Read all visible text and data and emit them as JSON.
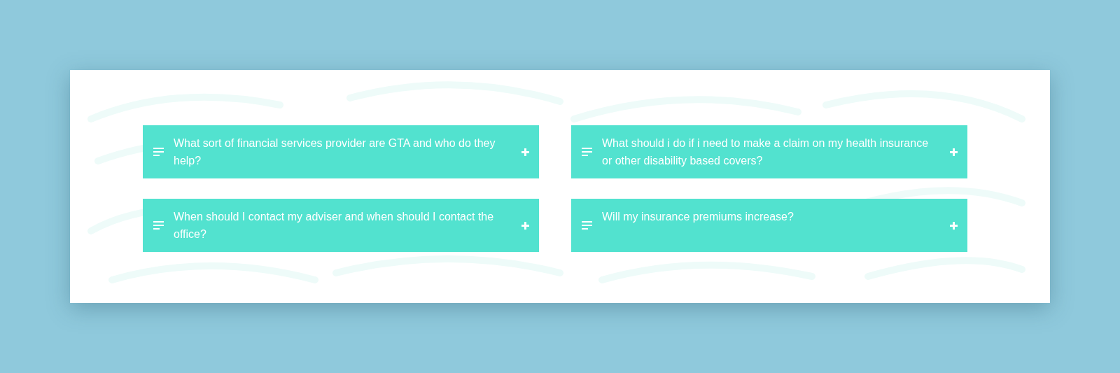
{
  "faq": [
    {
      "question": "What sort of financial services provider are GTA and who do they help?",
      "expanded": false
    },
    {
      "question": "What should i do if i need to make a claim on my health insurance or other disability based covers?",
      "expanded": false
    },
    {
      "question": "When should I contact my adviser and when should I contact the office?",
      "expanded": false
    },
    {
      "question": "Will my insurance premiums increase?",
      "expanded": false
    }
  ]
}
